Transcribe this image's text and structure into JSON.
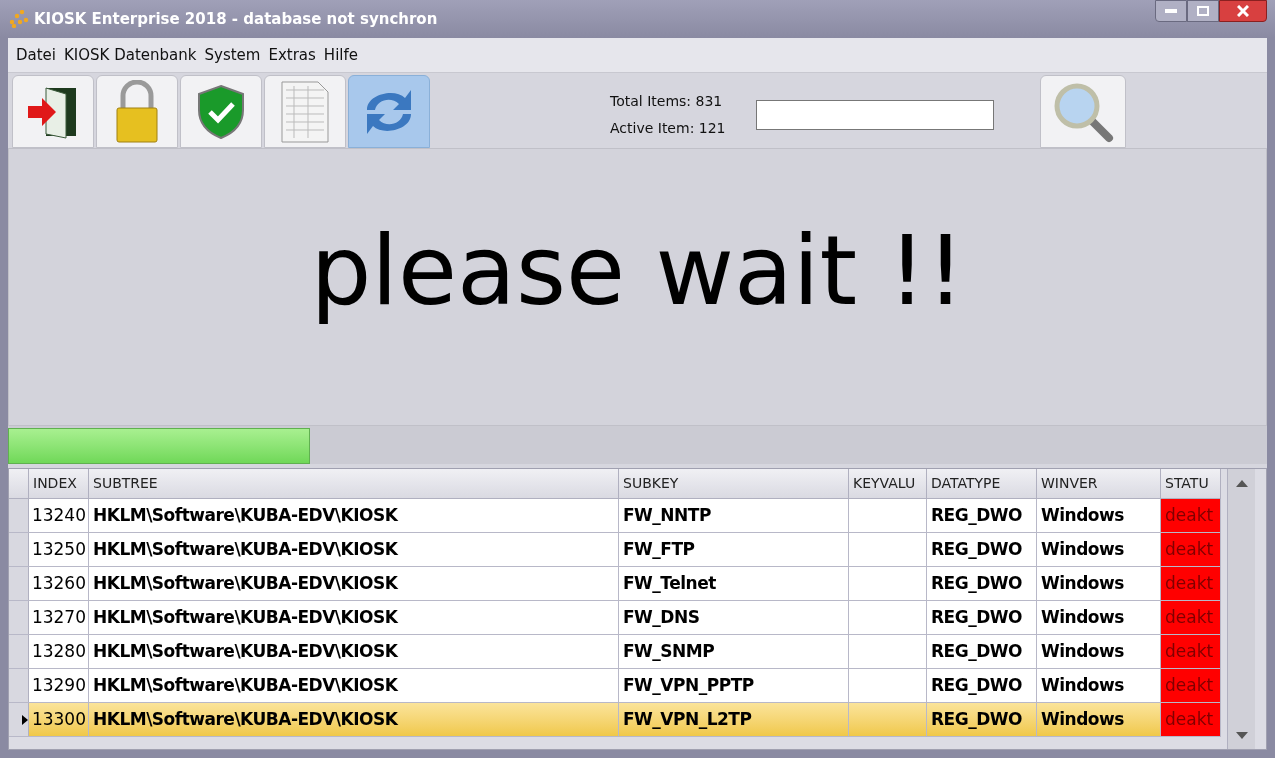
{
  "window": {
    "title": "KIOSK Enterprise 2018 - database not synchron"
  },
  "menu": [
    "Datei",
    "KIOSK Datenbank",
    "System",
    "Extras",
    "Hilfe"
  ],
  "toolbar": [
    {
      "kind": "exit",
      "selected": false
    },
    {
      "kind": "lock",
      "selected": false
    },
    {
      "kind": "shield",
      "selected": false
    },
    {
      "kind": "sheet",
      "selected": false
    },
    {
      "kind": "sync",
      "selected": true
    }
  ],
  "counts": [
    "Total Items: 831",
    "Active Item: 121"
  ],
  "message": "please wait !!",
  "progress": {
    "level": 0.24
  },
  "table": {
    "columns": [
      "INDEX",
      "SUBTREE",
      "SUBKEY",
      "KEYVALU",
      "DATATYPE",
      "WINVER",
      "STATU"
    ],
    "rows": [
      {
        "cells": [
          "13240",
          "HKLM\\Software\\KUBA-EDV\\KIOSK",
          "FW_NNTP",
          "",
          "REG_DWO",
          "Windows",
          "deakt"
        ],
        "color": "#ff0000",
        "selected": false
      },
      {
        "cells": [
          "13250",
          "HKLM\\Software\\KUBA-EDV\\KIOSK",
          "FW_FTP",
          "",
          "REG_DWO",
          "Windows",
          "deakt"
        ],
        "color": "#ff0000",
        "selected": false
      },
      {
        "cells": [
          "13260",
          "HKLM\\Software\\KUBA-EDV\\KIOSK",
          "FW_Telnet",
          "",
          "REG_DWO",
          "Windows",
          "deakt"
        ],
        "color": "#ff0000",
        "selected": false
      },
      {
        "cells": [
          "13270",
          "HKLM\\Software\\KUBA-EDV\\KIOSK",
          "FW_DNS",
          "",
          "REG_DWO",
          "Windows",
          "deakt"
        ],
        "color": "#ff0000",
        "selected": false
      },
      {
        "cells": [
          "13280",
          "HKLM\\Software\\KUBA-EDV\\KIOSK",
          "FW_SNMP",
          "",
          "REG_DWO",
          "Windows",
          "deakt"
        ],
        "color": "#ff0000",
        "selected": false
      },
      {
        "cells": [
          "13290",
          "HKLM\\Software\\KUBA-EDV\\KIOSK",
          "FW_VPN_PPTP",
          "",
          "REG_DWO",
          "Windows",
          "deakt"
        ],
        "color": "#ff0000",
        "selected": false
      },
      {
        "cells": [
          "13300",
          "HKLM\\Software\\KUBA-EDV\\KIOSK",
          "FW_VPN_L2TP",
          "",
          "REG_DWO",
          "Windows",
          "deakt"
        ],
        "color": "#ff0000",
        "selected": true
      }
    ]
  }
}
